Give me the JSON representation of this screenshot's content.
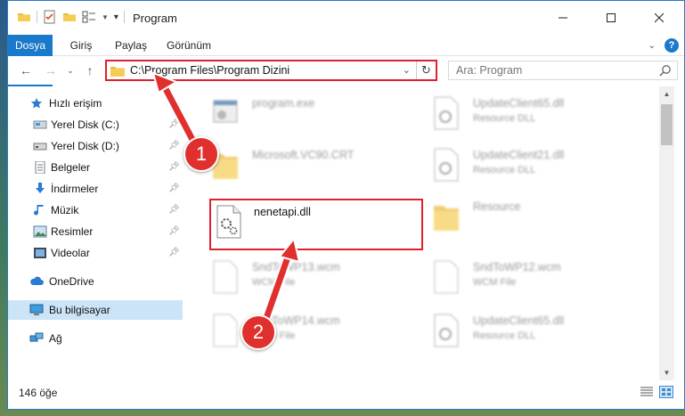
{
  "window": {
    "title": "Program"
  },
  "ribbon": {
    "tabs": [
      "Dosya",
      "Giriş",
      "Paylaş",
      "Görünüm"
    ]
  },
  "address": {
    "path": "C:\\Program Files\\Program Dizini"
  },
  "search": {
    "placeholder": "Ara: Program"
  },
  "sidebar": {
    "items": [
      {
        "label": "Hızlı erişim",
        "icon": "star-icon"
      },
      {
        "label": "Yerel Disk (C:)",
        "icon": "drive-icon",
        "pinned": true
      },
      {
        "label": "Yerel Disk (D:)",
        "icon": "drive-icon",
        "pinned": true
      },
      {
        "label": "Belgeler",
        "icon": "documents-icon",
        "pinned": true
      },
      {
        "label": "İndirmeler",
        "icon": "download-icon",
        "pinned": true
      },
      {
        "label": "Müzik",
        "icon": "music-icon",
        "pinned": true
      },
      {
        "label": "Resimler",
        "icon": "pictures-icon",
        "pinned": true
      },
      {
        "label": "Videolar",
        "icon": "videos-icon",
        "pinned": true
      },
      {
        "label": "OneDrive",
        "icon": "cloud-icon"
      },
      {
        "label": "Bu bilgisayar",
        "icon": "computer-icon",
        "selected": true
      },
      {
        "label": "Ağ",
        "icon": "network-icon"
      }
    ]
  },
  "files": [
    {
      "name": "program.exe",
      "type": "",
      "icon": "exe-icon"
    },
    {
      "name": "UpdateClient65.dll",
      "type": "Resource DLL",
      "icon": "dll-icon"
    },
    {
      "name": "Microsoft.VC90.CRT",
      "type": "",
      "icon": "folder-icon"
    },
    {
      "name": "UpdateClient21.dll",
      "type": "Resource DLL",
      "icon": "dll-icon"
    },
    {
      "name": "nenetapi.dll",
      "type": "",
      "icon": "dll-icon"
    },
    {
      "name": "Resource",
      "type": "",
      "icon": "folder-icon"
    },
    {
      "name": "SndToWP13.wcm",
      "type": "WCM File",
      "icon": "file-icon"
    },
    {
      "name": "SndToWP12.wcm",
      "type": "WCM File",
      "icon": "file-icon"
    },
    {
      "name": "SndToWP14.wcm",
      "type": "WCM File",
      "icon": "file-icon"
    },
    {
      "name": "UpdateClient65.dll",
      "type": "Resource DLL",
      "icon": "dll-icon"
    }
  ],
  "status": {
    "count": "146 öğe"
  },
  "annotations": {
    "step1": "1",
    "step2": "2"
  },
  "colors": {
    "accent": "#1979ca",
    "highlight": "#e0202e",
    "selected": "#cce4f7"
  }
}
